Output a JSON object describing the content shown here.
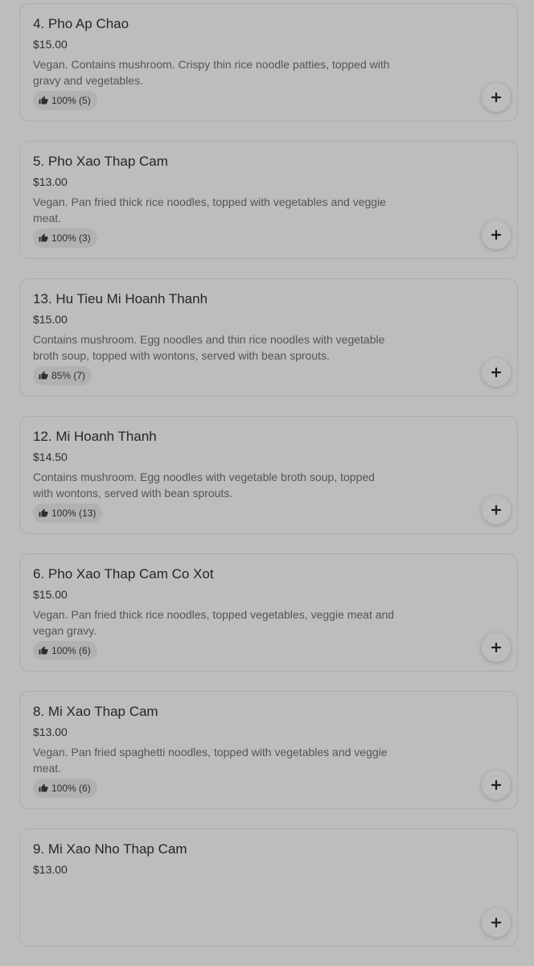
{
  "menu": {
    "items": [
      {
        "name": "4. Pho Ap Chao",
        "price": "$15.00",
        "description": "Vegan. Contains mushroom. Crispy thin rice noodle patties, topped with gravy and vegetables.",
        "rating": "100% (5)"
      },
      {
        "name": "5. Pho Xao Thap Cam",
        "price": "$13.00",
        "description": "Vegan. Pan fried thick rice noodles, topped with vegetables and veggie meat.",
        "rating": "100% (3)"
      },
      {
        "name": "13. Hu Tieu Mi Hoanh Thanh",
        "price": "$15.00",
        "description": "Contains mushroom. Egg noodles and thin rice noodles with vegetable broth soup, topped with wontons, served with bean sprouts.",
        "rating": "85% (7)"
      },
      {
        "name": "12. Mi Hoanh Thanh",
        "price": "$14.50",
        "description": "Contains mushroom. Egg noodles with vegetable broth soup, topped with wontons, served with bean sprouts.",
        "rating": "100% (13)"
      },
      {
        "name": "6. Pho Xao Thap Cam Co Xot",
        "price": "$15.00",
        "description": "Vegan. Pan fried thick rice noodles, topped vegetables, veggie meat and vegan gravy.",
        "rating": "100% (6)"
      },
      {
        "name": "8. Mi Xao Thap Cam",
        "price": "$13.00",
        "description": "Vegan. Pan fried spaghetti noodles, topped with vegetables and veggie meat.",
        "rating": "100% (6)"
      },
      {
        "name": "9. Mi Xao Nho Thap Cam",
        "price": "$13.00",
        "description": "",
        "rating": ""
      }
    ]
  },
  "icons": {
    "rating": "thumbs-up-icon",
    "add": "plus-icon"
  }
}
